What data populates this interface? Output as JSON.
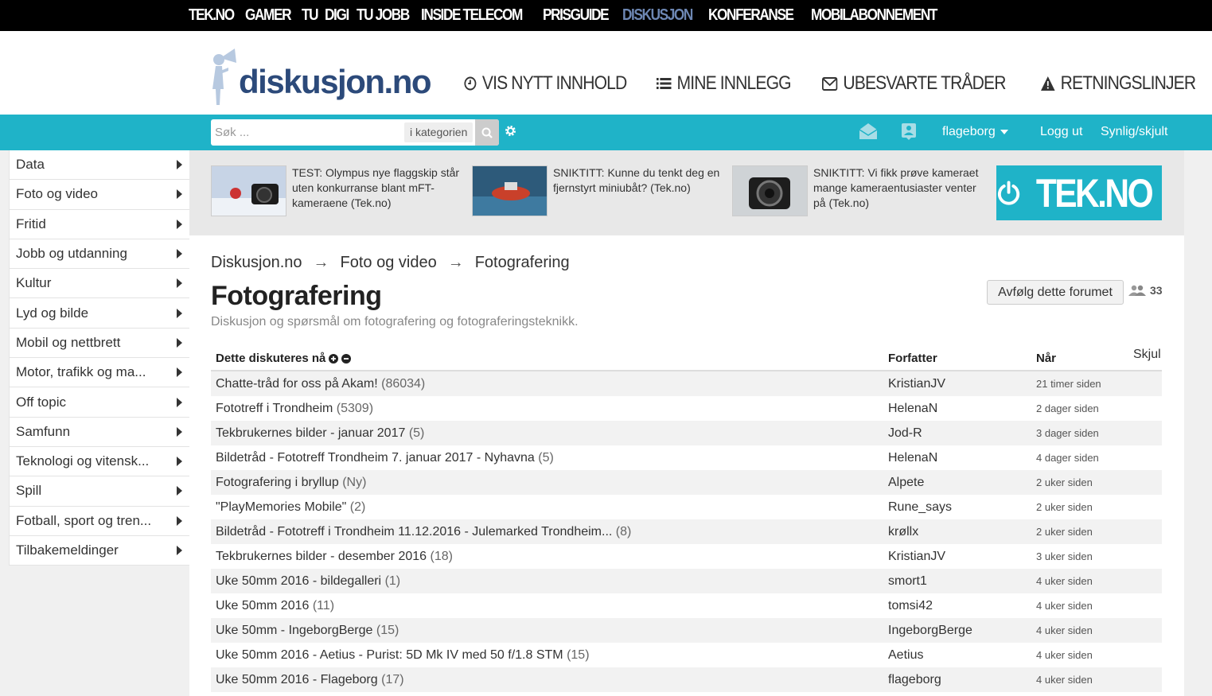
{
  "topnav": [
    "TEK.NO",
    "GAMER",
    "TU",
    "DIGI",
    "TU JOBB",
    "INSIDE TELECOM",
    "PRISGUIDE",
    "DISKUSJON",
    "KONFERANSE",
    "MOBILABONNEMENT"
  ],
  "topnav_active": "DISKUSJON",
  "header": {
    "logo_text": "diskusjon.no",
    "links": [
      "VIS NYTT INNHOLD",
      "MINE INNLEGG",
      "UBESVARTE TRÅDER",
      "RETNINGSLINJER"
    ]
  },
  "search": {
    "placeholder": "Søk ...",
    "category": "i kategorien"
  },
  "user": {
    "name": "flageborg",
    "logout": "Logg ut",
    "visibility": "Synlig/skjult"
  },
  "sidebar": [
    "Data",
    "Foto og video",
    "Fritid",
    "Jobb og utdanning",
    "Kultur",
    "Lyd og bilde",
    "Mobil og nettbrett",
    "Motor, trafikk og ma...",
    "Off topic",
    "Samfunn",
    "Teknologi og vitensk...",
    "Spill",
    "Fotball, sport og tren...",
    "Tilbakemeldinger"
  ],
  "promos": [
    "TEST: Olympus nye flaggskip står uten konkurranse blant mFT-kameraene (Tek.no)",
    "SNIKTITT: Kunne du tenkt deg en fjernstyrt miniubåt? (Tek.no)",
    "SNIKTITT: Vi fikk prøve kameraet mange kameraentusiaster venter på (Tek.no)"
  ],
  "tek_logo": "TEK.NO",
  "breadcrumb": [
    "Diskusjon.no",
    "Foto og video",
    "Fotografering"
  ],
  "breadcrumb_sep": "→",
  "page": {
    "title": "Fotografering",
    "description": "Diskusjon og spørsmål om fotografering og fotograferingsteknikk.",
    "follow_label": "Avfølg dette forumet",
    "followers": "33"
  },
  "table": {
    "header_title": "Dette diskuteres nå",
    "header_author": "Forfatter",
    "header_when": "Når",
    "hide": "Skjul",
    "rows": [
      {
        "title": "Chatte-tråd for oss på Akam!",
        "count": "(86034)",
        "author": "KristianJV",
        "when": "21 timer siden"
      },
      {
        "title": "Fototreff i Trondheim",
        "count": "(5309)",
        "author": "HelenaN",
        "when": "2 dager siden"
      },
      {
        "title": "Tekbrukernes bilder - januar 2017",
        "count": "(5)",
        "author": "Jod-R",
        "when": "3 dager siden"
      },
      {
        "title": "Bildetråd - Fototreff Trondheim 7. januar 2017 - Nyhavna",
        "count": "(5)",
        "author": "HelenaN",
        "when": "4 dager siden"
      },
      {
        "title": "Fotografering i bryllup",
        "count": "(Ny)",
        "author": "Alpete",
        "when": "2 uker siden"
      },
      {
        "title": "\"PlayMemories Mobile\"",
        "count": "(2)",
        "author": "Rune_says",
        "when": "2 uker siden"
      },
      {
        "title": "Bildetråd - Fototreff i Trondheim 11.12.2016 - Julemarked Trondheim...",
        "count": "(8)",
        "author": "krøllx",
        "when": "2 uker siden"
      },
      {
        "title": "Tekbrukernes bilder - desember 2016",
        "count": "(18)",
        "author": "KristianJV",
        "when": "3 uker siden"
      },
      {
        "title": "Uke 50mm 2016 - bildegalleri",
        "count": "(1)",
        "author": "smort1",
        "when": "4 uker siden"
      },
      {
        "title": "Uke 50mm 2016",
        "count": "(11)",
        "author": "tomsi42",
        "when": "4 uker siden"
      },
      {
        "title": "Uke 50mm - IngeborgBerge",
        "count": "(15)",
        "author": "IngeborgBerge",
        "when": "4 uker siden"
      },
      {
        "title": "Uke 50mm 2016 - Aetius - Purist: 5D Mk IV med 50 f/1.8 STM",
        "count": "(15)",
        "author": "Aetius",
        "when": "4 uker siden"
      },
      {
        "title": "Uke 50mm 2016 - Flageborg",
        "count": "(17)",
        "author": "flageborg",
        "when": "4 uker siden"
      }
    ]
  },
  "colors": {
    "teal": "#1fb3c8",
    "active_nav": "#6d87b3",
    "logo_blue": "#2c4a7a"
  }
}
